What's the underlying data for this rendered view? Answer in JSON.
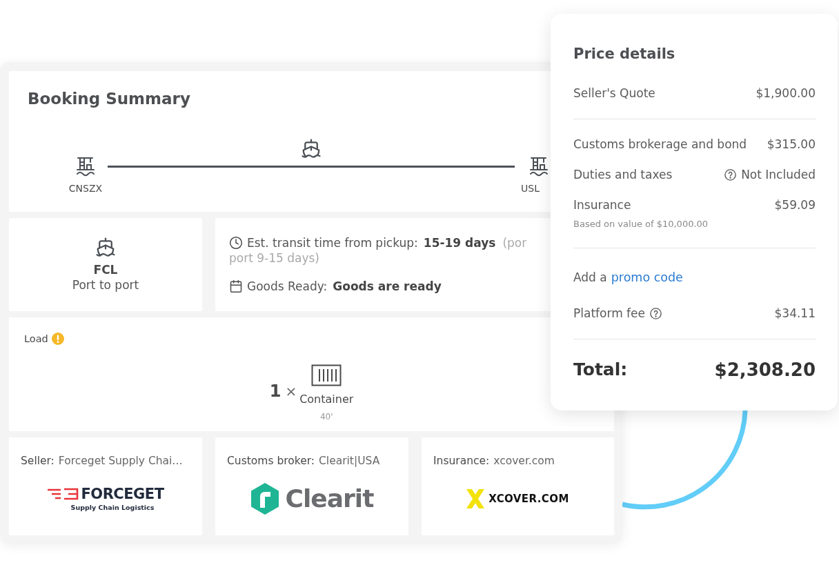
{
  "booking_summary": {
    "title": "Booking Summary",
    "route": {
      "origin": "CNSZX",
      "destination": "USL"
    },
    "service": {
      "mode": "FCL",
      "type": "Port to port"
    },
    "transit": {
      "label": "Est. transit time from pickup:",
      "value": "15-19 days",
      "note_parts": [
        "(por",
        "port 9-15 days)"
      ]
    },
    "goods_ready": {
      "label": "Goods Ready:",
      "value": "Goods are ready"
    },
    "load": {
      "label": "Load",
      "warning": true,
      "quantity": "1",
      "sign": "×",
      "unit": "Container",
      "size": "40'"
    },
    "parties": [
      {
        "label": "Seller:",
        "name": "Forceget Supply Chai…",
        "logo": {
          "kind": "forceget",
          "wordmark": "FORCEGET",
          "tagline": "Supply Chain Logistics"
        }
      },
      {
        "label": "Customs broker:",
        "name": "Clearit|USA",
        "logo": {
          "kind": "clearit",
          "wordmark": "Clearit"
        }
      },
      {
        "label": "Insurance:",
        "name": "xcover.com",
        "logo": {
          "kind": "xcover",
          "wordmark": "XCOVER.COM"
        }
      }
    ]
  },
  "price_details": {
    "title": "Price details",
    "sections": [
      {
        "rows": [
          {
            "kind": "line",
            "label": "Seller's Quote",
            "value": "$1,900.00",
            "label_help": false,
            "value_help": false
          }
        ]
      },
      {
        "rows": [
          {
            "kind": "line",
            "label": "Customs brokerage and bond",
            "value": "$315.00",
            "label_help": false,
            "value_help": false
          },
          {
            "kind": "line",
            "label": "Duties and taxes",
            "value": "Not Included",
            "label_help": false,
            "value_help": true
          },
          {
            "kind": "line",
            "label": "Insurance",
            "value": "$59.09",
            "note": "Based on value of $10,000.00",
            "label_help": false,
            "value_help": false
          }
        ]
      },
      {
        "rows": [
          {
            "kind": "promo",
            "prefix": "Add a",
            "link": "promo code"
          },
          {
            "kind": "line",
            "label": "Platform fee",
            "value": "$34.11",
            "label_help": true,
            "value_help": false
          }
        ]
      }
    ],
    "total": {
      "label": "Total:",
      "value": "$2,308.20"
    }
  }
}
